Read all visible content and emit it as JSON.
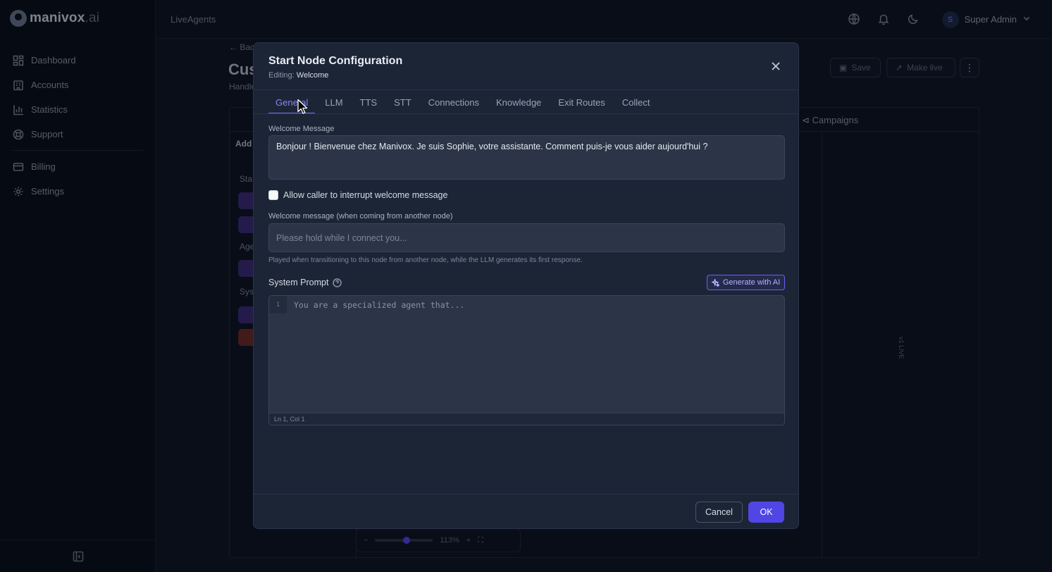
{
  "brand": {
    "name_bold": "manivox",
    "name_suffix": ".ai"
  },
  "sidebar": {
    "items": [
      {
        "label": "Dashboard",
        "icon": "dashboard-icon"
      },
      {
        "label": "Accounts",
        "icon": "building-icon"
      },
      {
        "label": "Statistics",
        "icon": "bar-chart-icon"
      },
      {
        "label": "Support",
        "icon": "lifebuoy-icon"
      },
      {
        "label": "Billing",
        "icon": "credit-card-icon"
      },
      {
        "label": "Settings",
        "icon": "gear-icon"
      }
    ]
  },
  "topbar": {
    "breadcrumb": "LiveAgents",
    "user_initial": "S",
    "user_name": "Super Admin"
  },
  "background": {
    "back": "Bac",
    "title": "Cus",
    "subtitle": "Handle",
    "save": "Save",
    "make_live": "Make live",
    "campaigns": "Campaigns",
    "add": "Add",
    "section_a": "Sta",
    "section_b": "Age",
    "section_c": "Sys",
    "live_badge": "v1 LIVE",
    "zoom": "113%"
  },
  "modal": {
    "title": "Start Node Configuration",
    "editing_prefix": "Editing:",
    "editing_name": "Welcome",
    "tabs": [
      "General",
      "LLM",
      "TTS",
      "STT",
      "Connections",
      "Knowledge",
      "Exit Routes",
      "Collect"
    ],
    "active_tab": "General",
    "welcome_label": "Welcome Message",
    "welcome_value": "Bonjour ! Bienvenue chez Manivox. Je suis Sophie, votre assistante. Comment puis-je vous aider aujourd'hui ?",
    "interrupt_label": "Allow caller to interrupt welcome message",
    "interrupt_checked": false,
    "transfer_label": "Welcome message (when coming from another node)",
    "transfer_placeholder": "Please hold while I connect you...",
    "transfer_hint": "Played when transitioning to this node from another node, while the LLM generates its first response.",
    "system_prompt_label": "System Prompt",
    "generate_label": "Generate with AI",
    "editor_line_number": "1",
    "editor_placeholder": "You are a specialized agent that...",
    "editor_status": "Ln 1, Col 1",
    "cancel_label": "Cancel",
    "ok_label": "OK"
  },
  "colors": {
    "accent": "#4f46e5",
    "tab_active": "#8b83f5",
    "modal_bg": "#1c2536",
    "page_bg": "#0f1729"
  }
}
